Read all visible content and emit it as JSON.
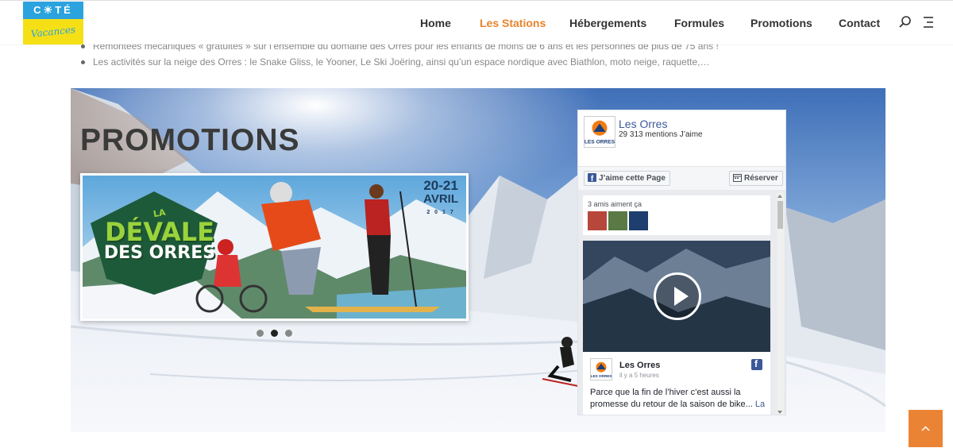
{
  "logo": {
    "top_text": "C☀TÉ",
    "bottom_text": "Vacances"
  },
  "nav": {
    "items": [
      {
        "label": "Home",
        "active": false
      },
      {
        "label": "Les Stations",
        "active": true
      },
      {
        "label": "Hébergements",
        "active": false
      },
      {
        "label": "Formules",
        "active": false
      },
      {
        "label": "Promotions",
        "active": false
      },
      {
        "label": "Contact",
        "active": false
      }
    ],
    "search_icon": "search-icon",
    "menu_icon": "menu-icon",
    "active_color": "#e8832b"
  },
  "bullets": [
    "Remontées mécaniques « gratuites » sur l’ensemble du domaine des Orres pour les enfants de moins de 6 ans et les personnes de plus de 75 ans !",
    "Les activités sur la neige des Orres : le Snake Gliss, le Yooner, Le Ski Joëring, ainsi qu’un espace nordique avec Biathlon, moto neige, raquette,…"
  ],
  "hero": {
    "title": "PROMOTIONS",
    "slide": {
      "date_line1": "20-21",
      "date_line2": "AVRIL",
      "date_line3": "2 0 1 7",
      "logo_line1": "LA",
      "logo_line2": "DÉVALE",
      "logo_line3": "DES ORRES"
    },
    "dots": [
      {
        "active": false
      },
      {
        "active": true
      },
      {
        "active": false
      }
    ]
  },
  "facebook": {
    "page_name": "Les Orres",
    "likes": "29 313 mentions J’aime",
    "avatar_text": "LES ORRES",
    "like_button": "J’aime cette Page",
    "reserve_button": "Réserver",
    "friends_label": "3 amis aiment ça",
    "post": {
      "author": "Les Orres",
      "time": "il y a 5 heures",
      "text": "Parce que la fin de l’hiver c’est aussi la promesse du retour de la saison de bike...",
      "more": "La"
    }
  },
  "back_to_top": "chevron-up-icon"
}
